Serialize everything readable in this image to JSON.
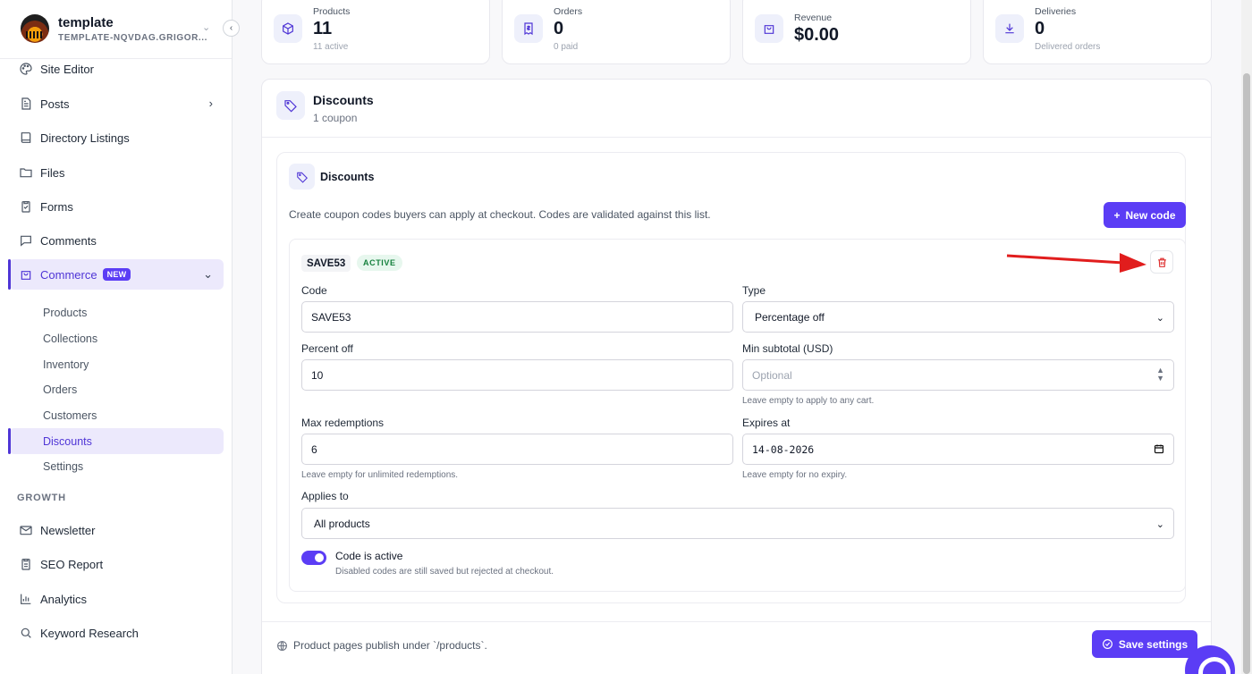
{
  "site": {
    "name": "template",
    "url": "TEMPLATE-NQVDAG.GRIGOR..."
  },
  "nav": [
    {
      "label": "Site Editor"
    },
    {
      "label": "Posts"
    },
    {
      "label": "Directory Listings"
    },
    {
      "label": "Files"
    },
    {
      "label": "Forms"
    },
    {
      "label": "Comments"
    },
    {
      "label": "Commerce",
      "badge": "NEW"
    }
  ],
  "commerce_sub": [
    "Products",
    "Collections",
    "Inventory",
    "Orders",
    "Customers",
    "Discounts",
    "Settings"
  ],
  "growth": {
    "label": "GROWTH",
    "items": [
      "Newsletter",
      "SEO Report",
      "Analytics",
      "Keyword Research"
    ]
  },
  "stats": [
    {
      "label": "Products",
      "value": "11",
      "sub": "11 active"
    },
    {
      "label": "Orders",
      "value": "0",
      "sub": "0 paid"
    },
    {
      "label": "Revenue",
      "value": "$0.00",
      "sub": ""
    },
    {
      "label": "Deliveries",
      "value": "0",
      "sub": "Delivered orders"
    }
  ],
  "panel": {
    "title": "Discounts",
    "subtitle": "1 coupon",
    "inner_title": "Discounts",
    "description": "Create coupon codes buyers can apply at checkout. Codes are validated against this list.",
    "new_button": "New code",
    "footer_note": "Product pages publish under `/products`.",
    "save_button": "Save settings"
  },
  "coupon": {
    "code_chip": "SAVE53",
    "status": "ACTIVE",
    "fields": {
      "code": {
        "label": "Code",
        "value": "SAVE53"
      },
      "type": {
        "label": "Type",
        "value": "Percentage off"
      },
      "percent_off": {
        "label": "Percent off",
        "value": "10"
      },
      "min_subtotal": {
        "label": "Min subtotal (USD)",
        "placeholder": "Optional",
        "help": "Leave empty to apply to any cart."
      },
      "max_redemptions": {
        "label": "Max redemptions",
        "value": "6",
        "help": "Leave empty for unlimited redemptions."
      },
      "expires_at": {
        "label": "Expires at",
        "value": "14-08-2026",
        "help": "Leave empty for no expiry."
      },
      "applies_to": {
        "label": "Applies to",
        "value": "All products"
      }
    },
    "active_toggle": {
      "label": "Code is active",
      "help": "Disabled codes are still saved but rejected at checkout.",
      "on": true
    }
  },
  "colors": {
    "accent": "#5b3df5",
    "active_bg": "#ece9fc",
    "success": "#15803d",
    "danger": "#dc2626",
    "arrow": "#e11d1d"
  },
  "icons": [
    "palette-icon",
    "document-icon",
    "book-icon",
    "folder-icon",
    "clipboard-icon",
    "chat-icon",
    "bag-icon",
    "mail-icon",
    "report-icon",
    "chart-icon",
    "search-icon",
    "cube-icon",
    "receipt-icon",
    "download-icon",
    "tag-icon",
    "trash-icon",
    "plus-icon",
    "check-circle-icon",
    "globe-icon"
  ]
}
